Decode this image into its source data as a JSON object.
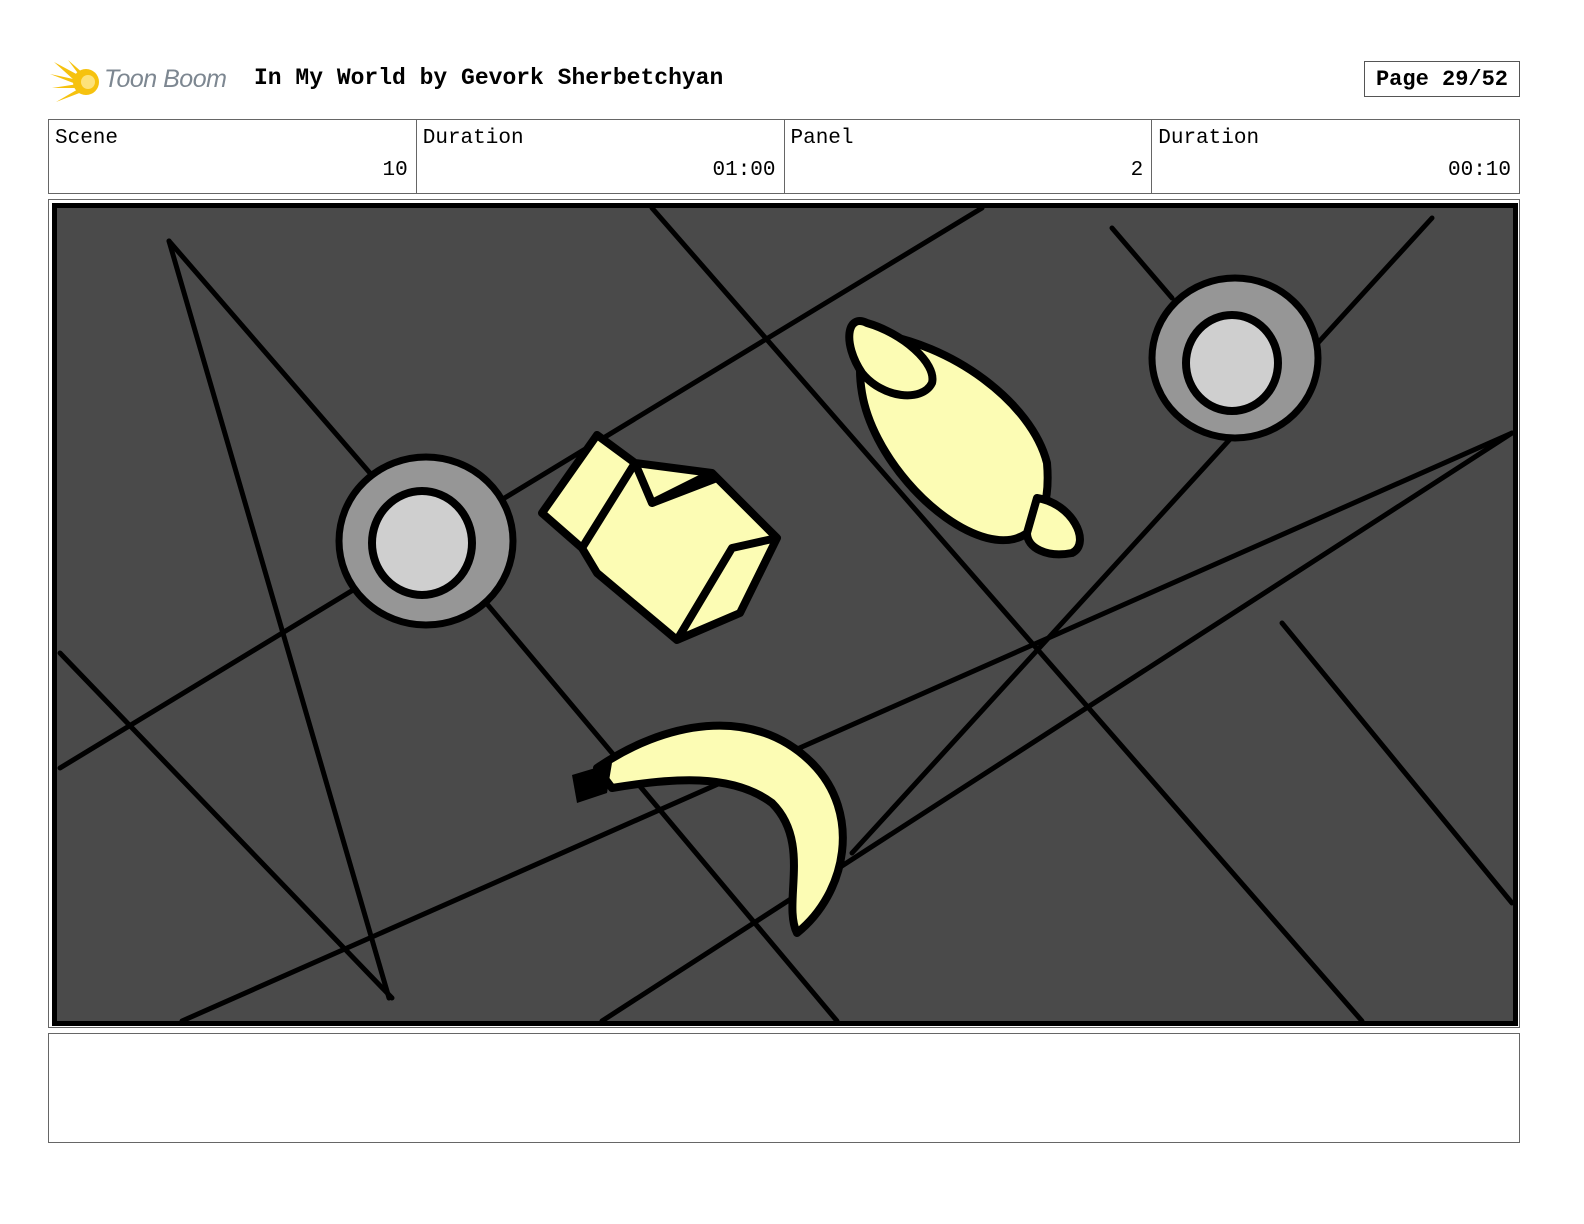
{
  "header": {
    "logo_text": "Toon Boom",
    "title": "In My World by Gevork Sherbetchyan",
    "page": "Page 29/52"
  },
  "info": {
    "scene_label": "Scene",
    "scene_value": "10",
    "scene_duration_label": "Duration",
    "scene_duration_value": "01:00",
    "panel_label": "Panel",
    "panel_value": "2",
    "panel_duration_label": "Duration",
    "panel_duration_value": "00:10"
  },
  "colors": {
    "floor": "#4a4a4a",
    "object_fill": "#fcfcb4",
    "plate_rim": "#969696",
    "plate_center": "#cfcfcf",
    "logo": "#f6c20f"
  },
  "notes": ""
}
